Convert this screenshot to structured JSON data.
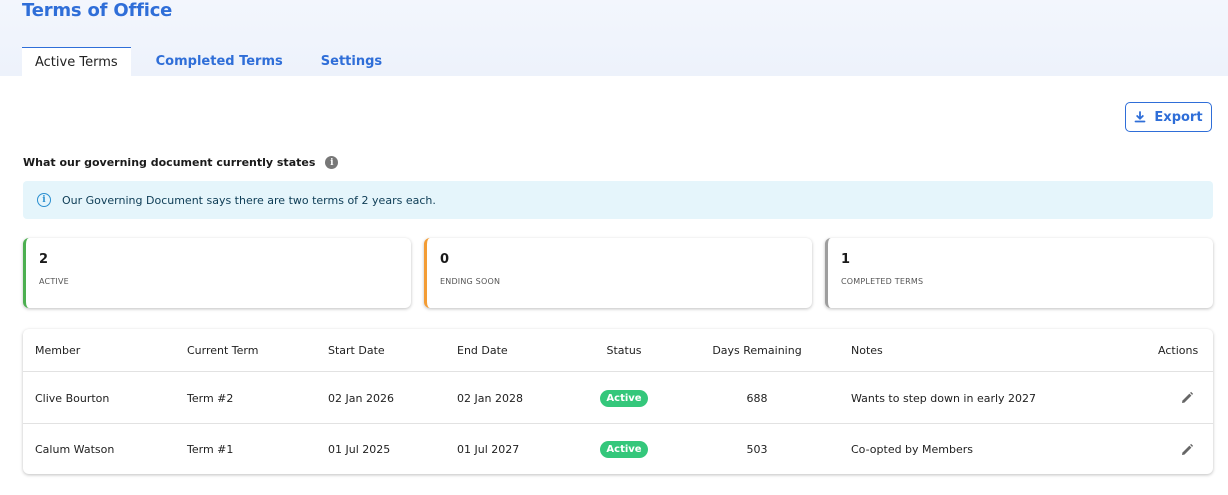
{
  "header": {
    "title": "Terms of Office"
  },
  "tabs": [
    {
      "label": "Active Terms",
      "active": true
    },
    {
      "label": "Completed Terms",
      "active": false
    },
    {
      "label": "Settings",
      "active": false
    }
  ],
  "toolbar": {
    "export_label": "Export",
    "export_icon": "download-icon"
  },
  "governing": {
    "heading": "What our governing document currently states",
    "notice": "Our Governing Document says there are two terms of 2 years each."
  },
  "stats": [
    {
      "value": "2",
      "label": "ACTIVE",
      "color": "#4caf50"
    },
    {
      "value": "0",
      "label": "ENDING SOON",
      "color": "#f39c34"
    },
    {
      "value": "1",
      "label": "COMPLETED TERMS",
      "color": "#9e9e9e"
    }
  ],
  "table": {
    "headers": [
      "Member",
      "Current Term",
      "Start Date",
      "End Date",
      "Status",
      "Days Remaining",
      "Notes",
      "Actions"
    ],
    "rows": [
      {
        "member": "Clive Bourton",
        "term": "Term #2",
        "start": "02 Jan 2026",
        "end": "02 Jan 2028",
        "status": "Active",
        "days": "688",
        "notes": "Wants to step down in early 2027"
      },
      {
        "member": "Calum Watson",
        "term": "Term #1",
        "start": "01 Jul 2025",
        "end": "01 Jul 2027",
        "status": "Active",
        "days": "503",
        "notes": "Co-opted by Members"
      }
    ]
  },
  "colors": {
    "accent": "#2f6ed8",
    "status_active": "#34c77b"
  }
}
